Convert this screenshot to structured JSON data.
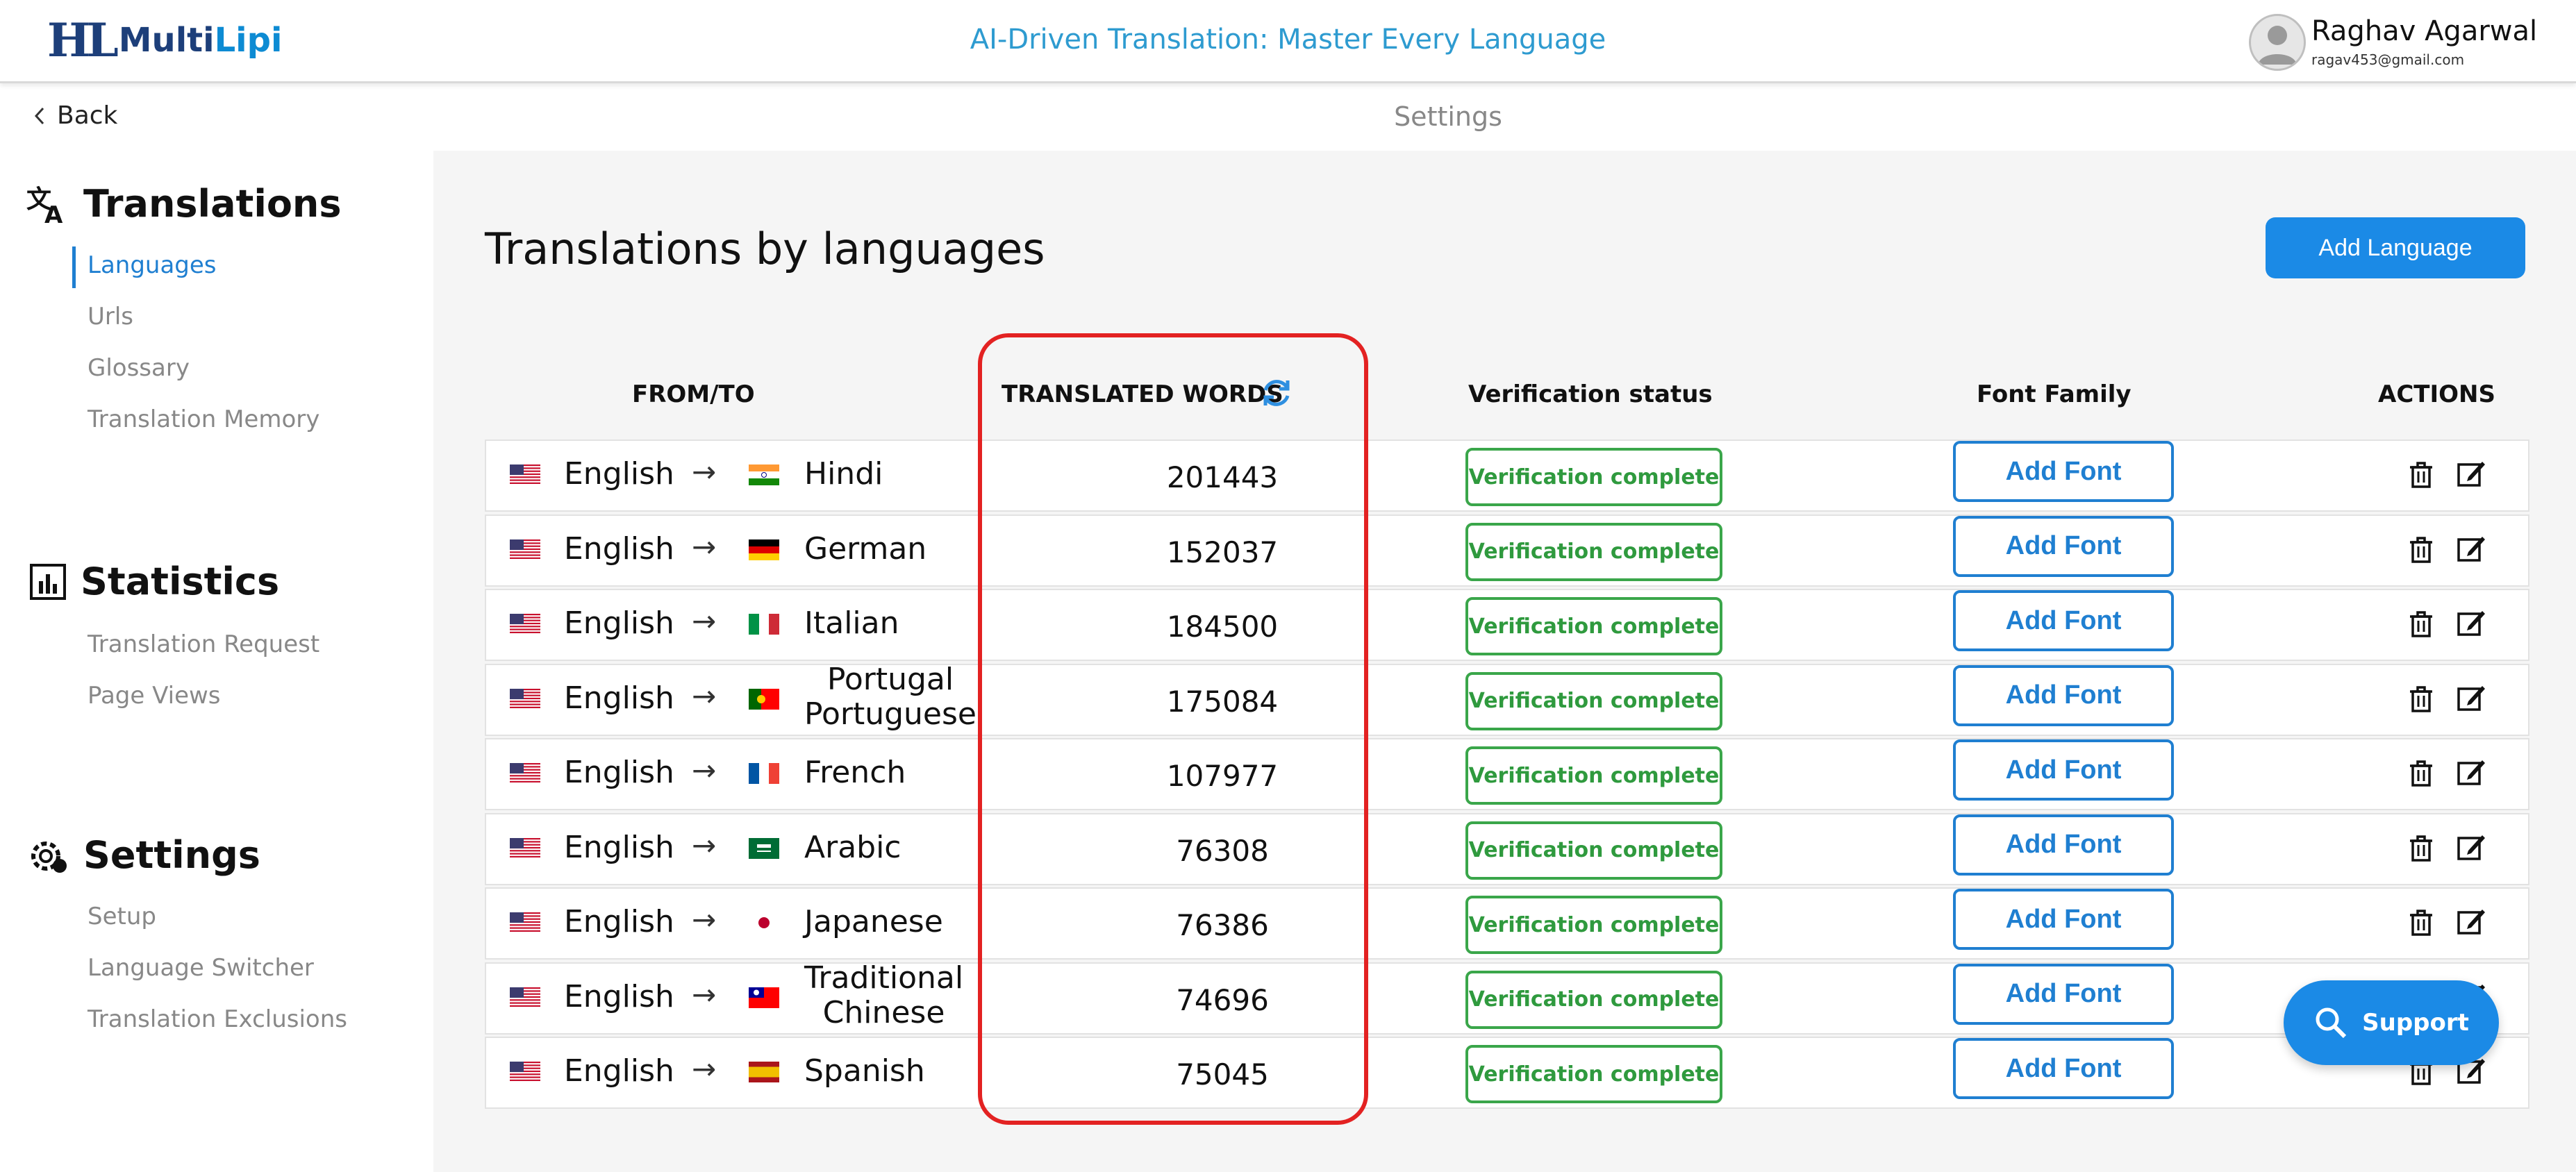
{
  "header": {
    "logo_mark": "HL",
    "logo_multi": "Multi",
    "logo_lipi": "Lipi",
    "tagline": "AI-Driven Translation: Master Every Language",
    "user_name": "Raghav Agarwal",
    "user_email": "ragav453@gmail.com"
  },
  "subheader": {
    "back_label": "Back",
    "title": "Settings"
  },
  "sidebar": {
    "sections": [
      {
        "title": "Translations",
        "icon": "translate-icon",
        "items": [
          "Languages",
          "Urls",
          "Glossary",
          "Translation Memory"
        ]
      },
      {
        "title": "Statistics",
        "icon": "bar-chart-icon",
        "items": [
          "Translation Request",
          "Page Views"
        ]
      },
      {
        "title": "Settings",
        "icon": "gear-icon",
        "items": [
          "Setup",
          "Language Switcher",
          "Translation Exclusions"
        ]
      }
    ],
    "active_item": "Languages"
  },
  "main": {
    "title": "Translations by languages",
    "add_language_label": "Add Language",
    "columns": [
      "FROM/TO",
      "TRANSLATED WORDS",
      "Verification status",
      "Font Family",
      "ACTIONS"
    ],
    "rows": [
      {
        "from": "English",
        "to": "Hindi",
        "to2": "",
        "flag": "in",
        "words": "201443",
        "status": "Verification complete",
        "font": "Add Font"
      },
      {
        "from": "English",
        "to": "German",
        "to2": "",
        "flag": "de",
        "words": "152037",
        "status": "Verification complete",
        "font": "Add Font"
      },
      {
        "from": "English",
        "to": "Italian",
        "to2": "",
        "flag": "it",
        "words": "184500",
        "status": "Verification complete",
        "font": "Add Font"
      },
      {
        "from": "English",
        "to": "Portugal",
        "to2": "Portuguese",
        "flag": "pt",
        "words": "175084",
        "status": "Verification complete",
        "font": "Add Font"
      },
      {
        "from": "English",
        "to": "French",
        "to2": "",
        "flag": "fr",
        "words": "107977",
        "status": "Verification complete",
        "font": "Add Font"
      },
      {
        "from": "English",
        "to": "Arabic",
        "to2": "",
        "flag": "sa",
        "words": "76308",
        "status": "Verification complete",
        "font": "Add Font"
      },
      {
        "from": "English",
        "to": "Japanese",
        "to2": "",
        "flag": "jp",
        "words": "76386",
        "status": "Verification complete",
        "font": "Add Font"
      },
      {
        "from": "English",
        "to": "Traditional",
        "to2": "Chinese",
        "flag": "tw",
        "words": "74696",
        "status": "Verification complete",
        "font": "Add Font"
      },
      {
        "from": "English",
        "to": "Spanish",
        "to2": "",
        "flag": "es",
        "words": "75045",
        "status": "Verification complete",
        "font": "Add Font"
      }
    ]
  },
  "support_label": "Support",
  "colors": {
    "accent": "#1b8ae6",
    "verified_green": "#3aa64a",
    "highlight_red": "#e32222"
  }
}
